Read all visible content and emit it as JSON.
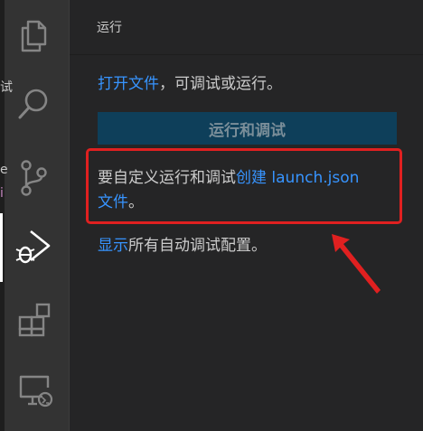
{
  "activity_bar": {
    "icons": [
      "explorer-icon",
      "search-icon",
      "source-control-icon",
      "run-debug-icon",
      "extensions-icon",
      "remote-explorer-icon"
    ],
    "active": "run-debug-icon",
    "edge_chars": [
      "试",
      "e",
      "i"
    ]
  },
  "panel": {
    "title": "运行",
    "open_file_link": "打开文件",
    "open_file_suffix": "，可调试或运行。",
    "run_button": "运行和调试",
    "customize_prefix": "要自定义运行和调试",
    "create_link_line1": "创建 launch.json",
    "create_link_line2": "文件",
    "customize_suffix": "。",
    "show_link": "显示",
    "show_suffix": "所有自动调试配置。"
  },
  "colors": {
    "activity_bar": "#333333",
    "sidebar": "#252526",
    "link": "#3794ff",
    "button": "#0e3f5a",
    "annotation": "#e02020"
  }
}
